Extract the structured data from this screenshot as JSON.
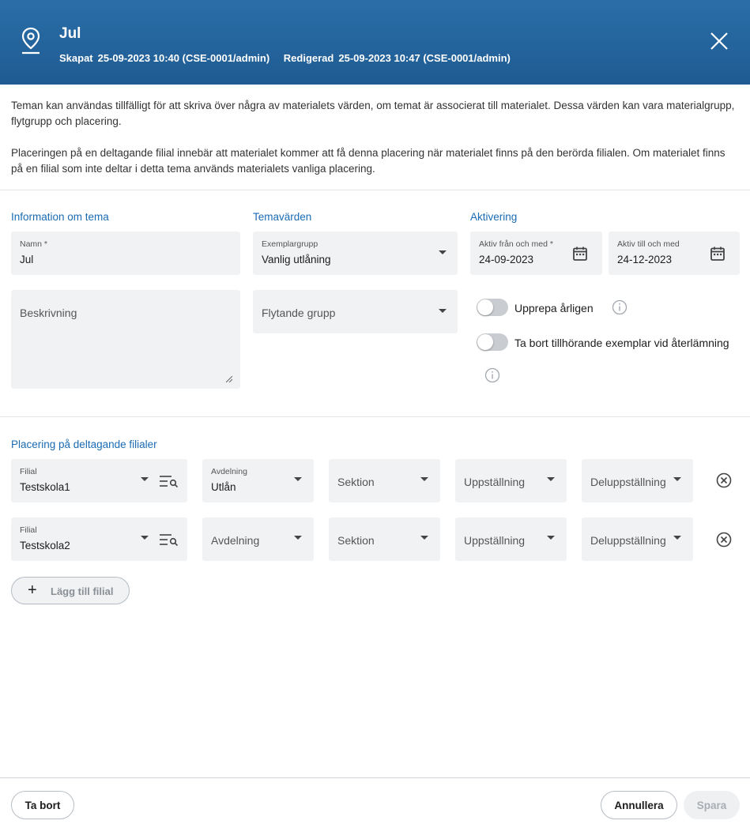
{
  "header": {
    "title": "Jul",
    "created_label": "Skapat",
    "created_value": "25-09-2023 10:40 (CSE-0001/admin)",
    "edited_label": "Redigerad",
    "edited_value": "25-09-2023 10:47 (CSE-0001/admin)",
    "icon": "location-pin-icon",
    "close_icon": "close-icon"
  },
  "intro": {
    "p1": "Teman kan användas tillfälligt för att skriva över några av materialets värden, om temat är associerat till materialet. Dessa värden kan vara materialgrupp, flytgrupp och placering.",
    "p2": "Placeringen på en deltagande filial innebär att materialet kommer att få denna placering när materialet finns på den berörda filialen. Om materialet finns på en filial som inte deltar i detta tema används materialets vanliga placering."
  },
  "info_section": {
    "title": "Information om tema",
    "name_label": "Namn *",
    "name_value": "Jul",
    "description_placeholder": "Beskrivning"
  },
  "theme_values": {
    "title": "Temavärden",
    "copy_group_label": "Exemplargrupp",
    "copy_group_value": "Vanlig utlåning",
    "floating_group_placeholder": "Flytande grupp"
  },
  "activation": {
    "title": "Aktivering",
    "from_label": "Aktiv från och med *",
    "from_value": "24-09-2023",
    "to_label": "Aktiv till och med",
    "to_value": "24-12-2023",
    "repeat_label": "Upprepa årligen",
    "repeat_on": false,
    "remove_label": "Ta bort tillhörande exemplar vid återlämning",
    "remove_on": false
  },
  "placement": {
    "title": "Placering på deltagande filialer",
    "rows": [
      {
        "branch_label": "Filial",
        "branch_value": "Testskola1",
        "department_label": "Avdelning",
        "department_value": "Utlån",
        "section": "Sektion",
        "arrangement": "Uppställning",
        "subarrangement": "Deluppställning"
      },
      {
        "branch_label": "Filial",
        "branch_value": "Testskola2",
        "department": "Avdelning",
        "section": "Sektion",
        "arrangement": "Uppställning",
        "subarrangement": "Deluppställning"
      }
    ],
    "add_label": "Lägg till filial"
  },
  "footer": {
    "delete_label": "Ta bort",
    "cancel_label": "Annullera",
    "save_label": "Spara"
  },
  "colors": {
    "header": "#1f5b92",
    "accent": "#1a6bb3",
    "field_bg": "#f0f2f4"
  }
}
